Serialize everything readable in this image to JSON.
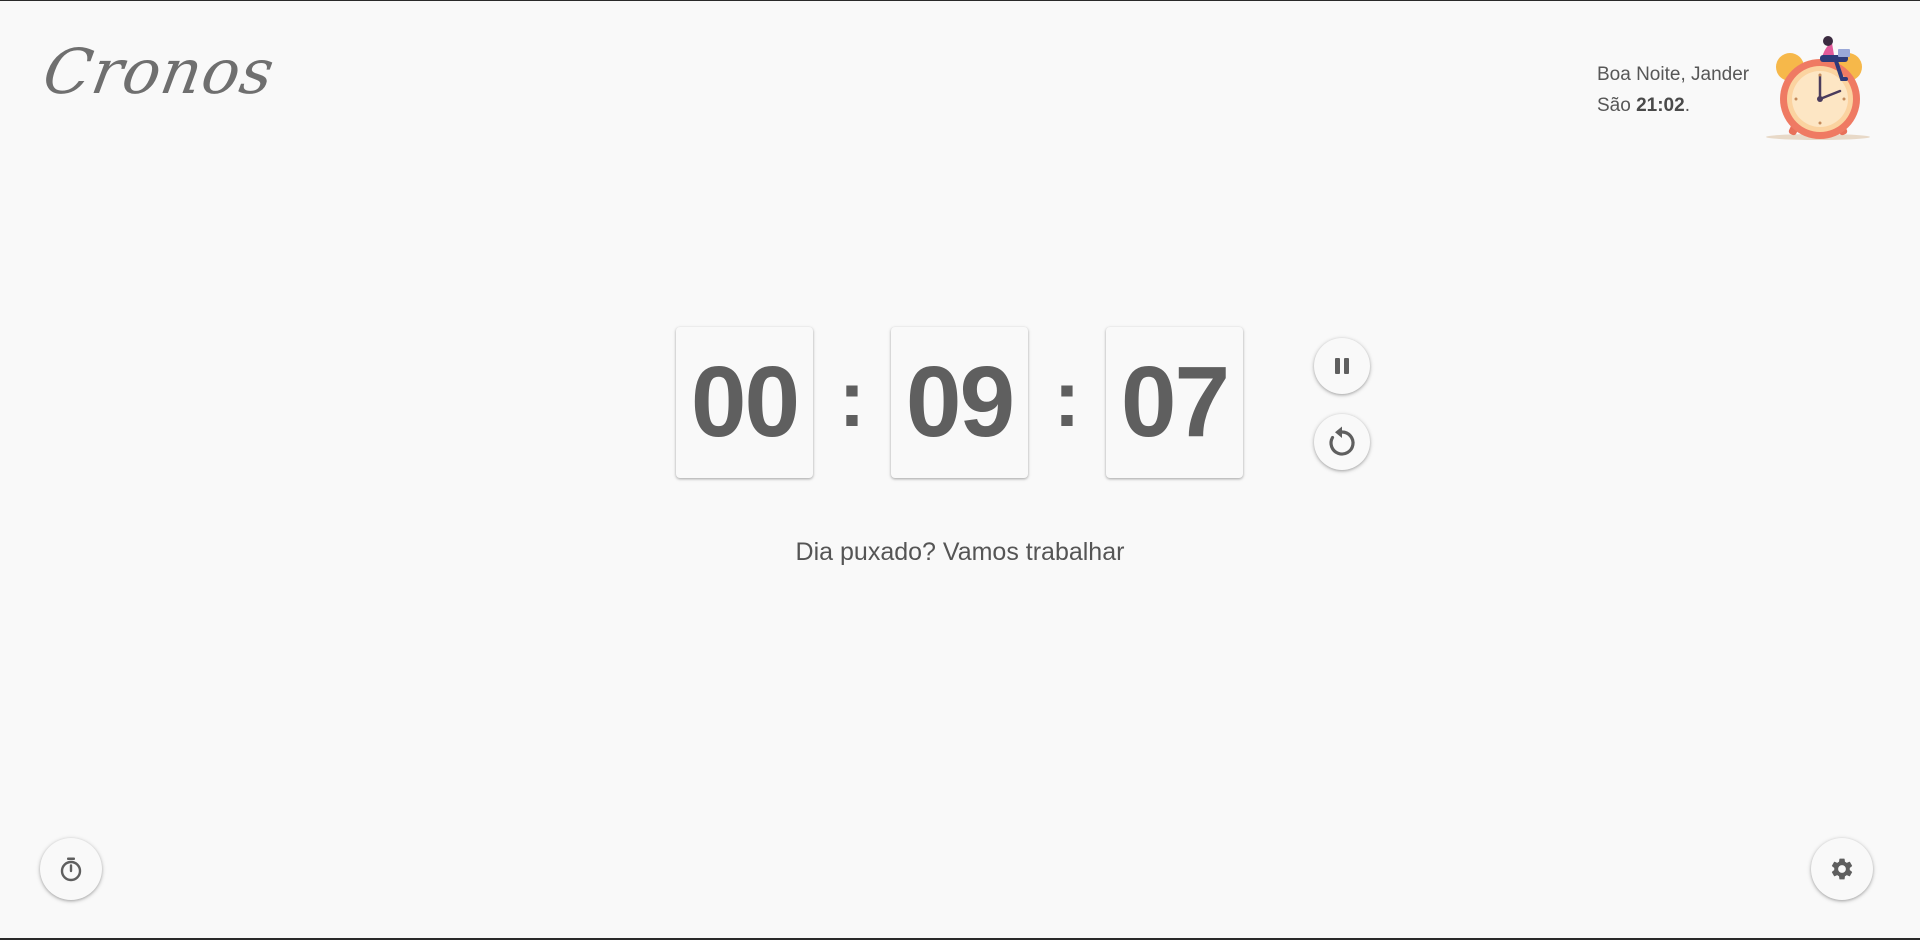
{
  "app": {
    "logo_text": "Cronos"
  },
  "header": {
    "greeting": "Boa Noite, Jander",
    "time_prefix": "São ",
    "time_value": "21:02",
    "time_suffix": "."
  },
  "timer": {
    "hours": "00",
    "minutes": "09",
    "seconds": "07",
    "separator": ":"
  },
  "controls": {
    "pause_icon": "pause-icon",
    "reset_icon": "reset-icon",
    "timer_mode_icon": "stopwatch-icon",
    "settings_icon": "gear-icon"
  },
  "message": "Dia puxado? Vamos trabalhar",
  "colors": {
    "background": "#f9f9f9",
    "text": "#555555",
    "digits": "#5f5f5f"
  }
}
